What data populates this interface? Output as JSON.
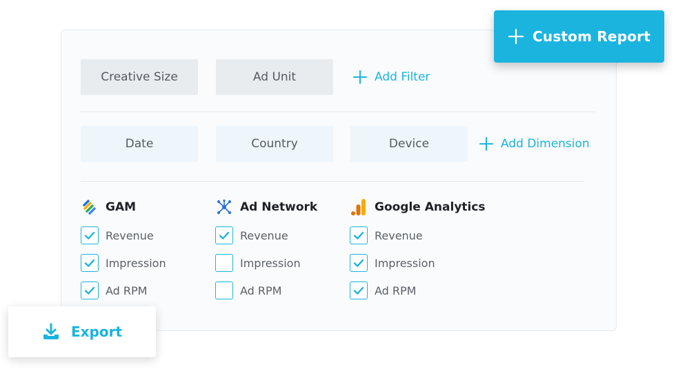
{
  "filters": {
    "chips": [
      "Creative Size",
      "Ad Unit"
    ],
    "add_label": "Add Filter"
  },
  "dimensions": {
    "chips": [
      "Date",
      "Country",
      "Device"
    ],
    "add_label": "Add Dimension"
  },
  "groups": [
    {
      "title": "GAM",
      "icon": "gam-icon",
      "options": [
        {
          "label": "Revenue",
          "checked": true
        },
        {
          "label": "Impression",
          "checked": true
        },
        {
          "label": "Ad RPM",
          "checked": true
        }
      ]
    },
    {
      "title": "Ad Network",
      "icon": "ad-network-icon",
      "options": [
        {
          "label": "Revenue",
          "checked": true
        },
        {
          "label": "Impression",
          "checked": false
        },
        {
          "label": "Ad RPM",
          "checked": false
        }
      ]
    },
    {
      "title": "Google Analytics",
      "icon": "google-analytics-icon",
      "options": [
        {
          "label": "Revenue",
          "checked": true
        },
        {
          "label": "Impression",
          "checked": true
        },
        {
          "label": "Ad RPM",
          "checked": true
        }
      ]
    }
  ],
  "custom_report": {
    "label": "Custom Report"
  },
  "export": {
    "label": "Export"
  },
  "colors": {
    "accent": "#1bb4de",
    "chip_filter": "#e8ecef",
    "chip_dimension": "#eef6fc",
    "ga_orange": "#f9ab00",
    "ga_dark_orange": "#e37400"
  }
}
